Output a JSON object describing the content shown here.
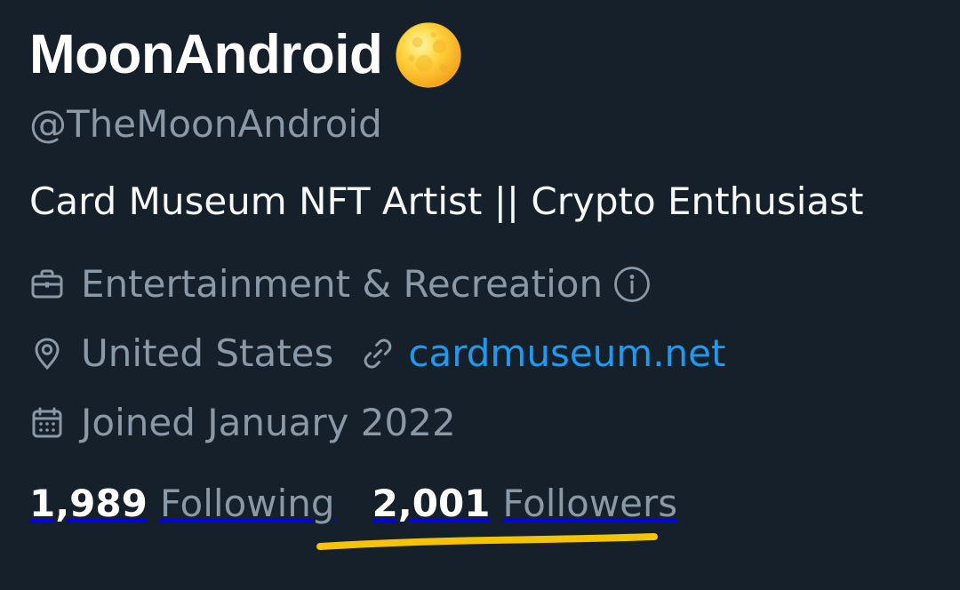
{
  "profile": {
    "display_name": "MoonAndroid",
    "name_emoji": "moon-emoji",
    "handle": "@TheMoonAndroid",
    "bio": "Card Museum NFT Artist || Crypto Enthusiast",
    "category": "Entertainment & Recreation",
    "location": "United States",
    "website": "cardmuseum.net",
    "joined": "Joined January 2022",
    "following_count": "1,989",
    "following_label": "Following",
    "followers_count": "2,001",
    "followers_label": "Followers"
  },
  "icons": {
    "category": "briefcase-icon",
    "category_info": "info-icon",
    "location": "location-pin-icon",
    "website": "link-icon",
    "joined": "calendar-icon"
  },
  "colors": {
    "background": "#15202b",
    "primary_text": "#ffffff",
    "secondary_text": "#8b98a5",
    "link": "#1d9bf0",
    "highlight_underline": "#f5c400"
  }
}
